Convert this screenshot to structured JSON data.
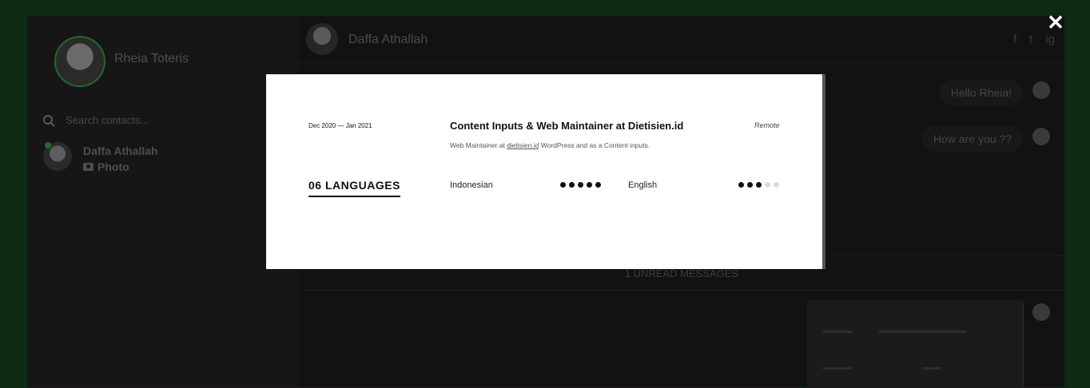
{
  "sidebar": {
    "profile_name": "Rheia Toteris",
    "search_placeholder": "Search contacts...",
    "contacts": [
      {
        "name": "Daffa Athallah",
        "last_message": "Photo"
      }
    ]
  },
  "chat": {
    "contact_name": "Daffa Athallah",
    "social": [
      "f",
      "t",
      "ig"
    ],
    "messages": [
      "Hello Rheia!",
      "How are you ??"
    ],
    "unread_label": "1 UNREAD MESSAGES"
  },
  "modal": {
    "close_label": "✕",
    "experience": {
      "period": "Dec 2020 — Jan 2021",
      "title": "Content Inputs & Web Maintainer at Dietisien.id",
      "mode": "Remote",
      "desc_before": "Web Maintainer at ",
      "desc_link": "dietisien.id",
      "desc_after": " WordPress and as a Content inputs."
    },
    "section_title": "06  LANGUAGES",
    "languages": [
      {
        "name": "Indonesian",
        "level": 5,
        "max": 5
      },
      {
        "name": "English",
        "level": 3,
        "max": 5
      }
    ]
  },
  "colors": {
    "accent": "#1d6b30",
    "backdrop": "#0d2a12"
  }
}
